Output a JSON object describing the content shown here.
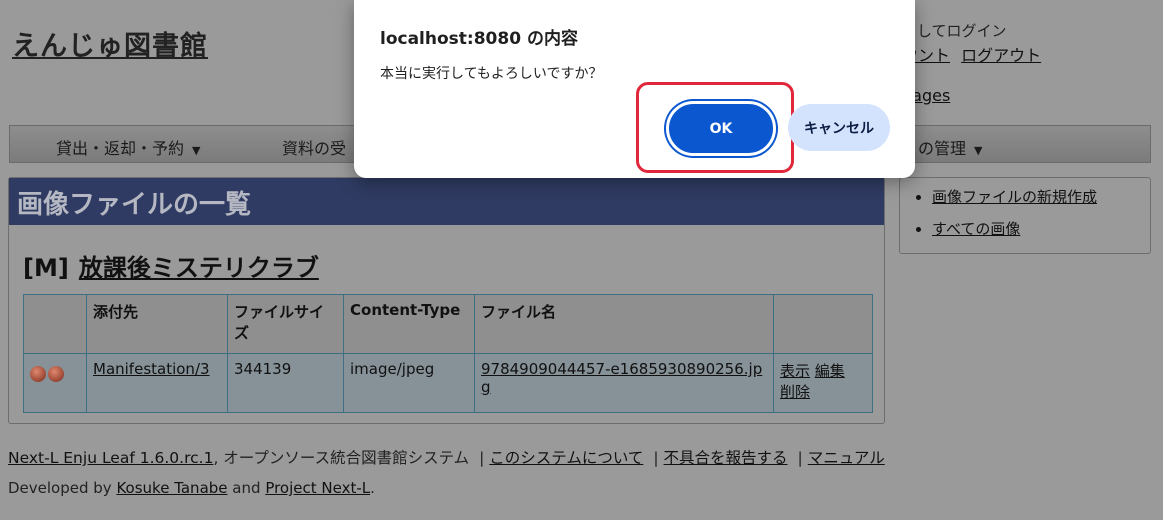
{
  "header": {
    "site_title": "えんじゅ図書館",
    "login_text": "としてログイン",
    "account_link": "ウント",
    "logout_link": "ログアウト",
    "languages_link": "uages"
  },
  "nav": {
    "items": [
      {
        "label": "貸出・返却・予約",
        "caret": "▼"
      },
      {
        "label": "資料の受",
        "caret": ""
      },
      {
        "label": "の管理",
        "caret": "▼"
      }
    ]
  },
  "main": {
    "heading": "画像ファイルの一覧",
    "manifestation_code": "[M]",
    "manifestation_title": "放課後ミステリクラブ",
    "table": {
      "headers": [
        "",
        "添付先",
        "ファイルサイズ",
        "Content-Type",
        "ファイル名",
        ""
      ],
      "rows": [
        {
          "attachable": "Manifestation/3",
          "size": "344139",
          "content_type": "image/jpeg",
          "filename": "9784909044457-e1685930890256.jpg",
          "actions": {
            "show": "表示",
            "edit": "編集",
            "delete": "削除"
          }
        }
      ]
    }
  },
  "side": {
    "links": [
      "画像ファイルの新規作成",
      "すべての画像"
    ]
  },
  "footer": {
    "product": "Next-L Enju Leaf 1.6.0.rc.1",
    "description": ", オープンソース統合図書館システム",
    "about": "このシステムについて",
    "report": "不具合を報告する",
    "manual": "マニュアル",
    "separator": "|",
    "developed_by": "Developed by",
    "author": "Kosuke Tanabe",
    "and": "and",
    "project": "Project Next-L",
    "period": "."
  },
  "dialog": {
    "title": "localhost:8080 の内容",
    "message": "本当に実行してもよろしいですか？",
    "ok_label": "OK",
    "cancel_label": "キャンセル"
  },
  "colors": {
    "overlay_background": "#9a9a9a",
    "heading_bg": "#2f3b62",
    "ok_button": "#0b57d0",
    "cancel_button": "#d3e3fd",
    "highlight": "#e0283a"
  }
}
